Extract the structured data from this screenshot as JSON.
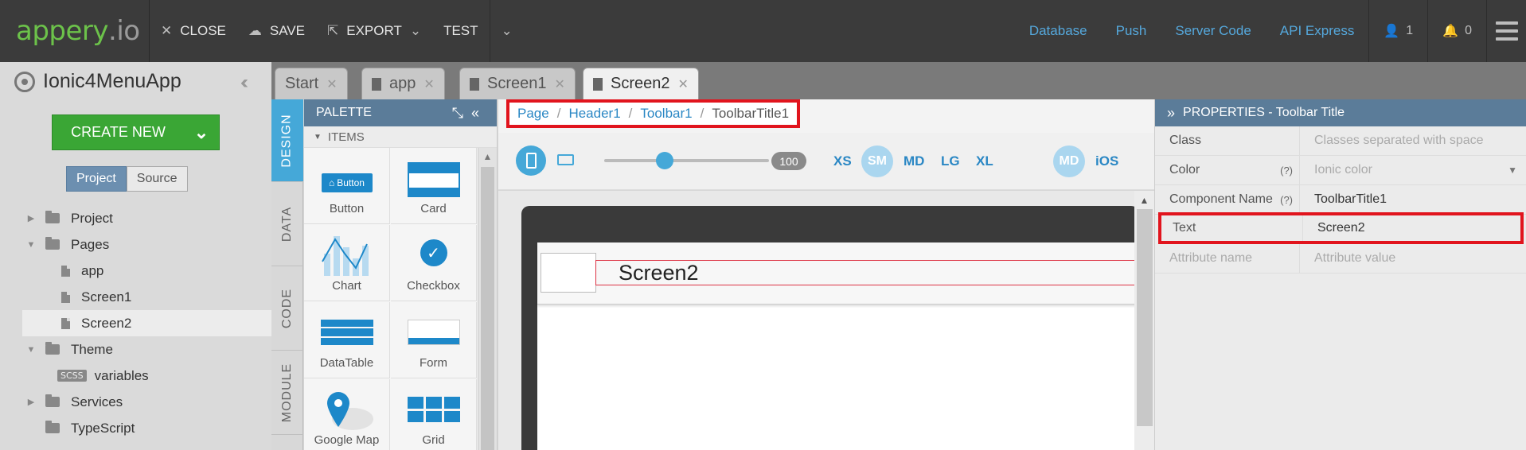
{
  "topbar": {
    "logo_main": "appery",
    "logo_suffix": ".io",
    "close": "CLOSE",
    "save": "SAVE",
    "export": "EXPORT",
    "test": "TEST",
    "links": [
      "Database",
      "Push",
      "Server Code",
      "API Express"
    ],
    "user_count": "1",
    "notif_count": "0"
  },
  "project": {
    "name": "Ionic4MenuApp",
    "create_new": "CREATE NEW",
    "seg_project": "Project",
    "seg_source": "Source",
    "tree": [
      {
        "label": "Project",
        "type": "folder",
        "expanded": false
      },
      {
        "label": "Pages",
        "type": "folder",
        "expanded": true
      },
      {
        "label": "app",
        "type": "page"
      },
      {
        "label": "Screen1",
        "type": "file"
      },
      {
        "label": "Screen2",
        "type": "file",
        "selected": true
      },
      {
        "label": "Theme",
        "type": "folder",
        "expanded": true
      },
      {
        "label": "variables",
        "type": "scss",
        "badge": "SCSS"
      },
      {
        "label": "Services",
        "type": "folder",
        "expanded": false
      },
      {
        "label": "TypeScript",
        "type": "folder"
      }
    ]
  },
  "tabs": [
    {
      "label": "Start"
    },
    {
      "label": "app"
    },
    {
      "label": "Screen1"
    },
    {
      "label": "Screen2",
      "active": true
    }
  ],
  "sidetabs": [
    "DESIGN",
    "DATA",
    "CODE",
    "MODULE"
  ],
  "palette": {
    "title": "PALETTE",
    "section": "ITEMS",
    "items": [
      "Button",
      "Card",
      "Chart",
      "Checkbox",
      "DataTable",
      "Form",
      "Google Map",
      "Grid"
    ],
    "button_preview": "Button"
  },
  "breadcrumb": [
    "Page",
    "Header1",
    "Toolbar1",
    "ToolbarTitle1"
  ],
  "device": {
    "zoom": "100",
    "slider_fraction": 0.33,
    "breakpoints": [
      "XS",
      "SM",
      "MD",
      "LG",
      "XL"
    ],
    "active_breakpoint": "SM",
    "platforms": [
      "MD",
      "iOS"
    ]
  },
  "canvas": {
    "title": "Screen2"
  },
  "properties": {
    "title": "PROPERTIES - Toolbar Title",
    "rows": [
      {
        "key": "Class",
        "value": "Classes separated with space",
        "placeholder": true
      },
      {
        "key": "Color",
        "help": "(?)",
        "value": "Ionic color",
        "placeholder": true,
        "dropdown": true
      },
      {
        "key": "Component Name",
        "help": "(?)",
        "value": "ToolbarTitle1"
      },
      {
        "key": "Text",
        "value": "Screen2",
        "highlight": true
      },
      {
        "key": "Attribute name",
        "value": "Attribute value",
        "placeholder": true,
        "keyPlaceholder": true
      }
    ]
  },
  "colors": {
    "accent_blue": "#45a8d8",
    "create_green": "#3aa635",
    "highlight_red": "#e1141d",
    "header_slate": "#5b7c99"
  }
}
